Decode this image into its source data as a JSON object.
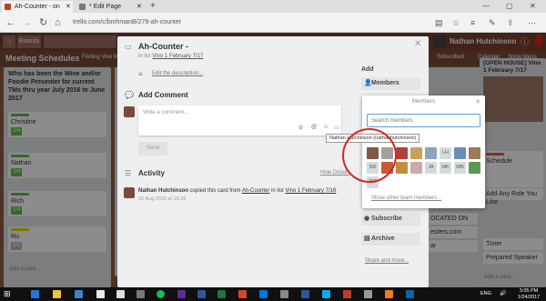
{
  "browser": {
    "tabs": [
      {
        "title": "Ah-Counter - on Meet",
        "active": true
      },
      {
        "title": "* Edit Page",
        "active": false
      }
    ],
    "tab_close": "✕",
    "url": "trello.com/c/bmhmanB/278-ah-counter"
  },
  "trello_header": {
    "boards_label": "Boards",
    "user_name": "Nathan Hutchinson"
  },
  "board": {
    "title": "Meeting Schedules",
    "menu_items": [
      "Finding Vino M...",
      "Subscribed",
      "Calendar",
      "Show Menu"
    ],
    "lists": [
      {
        "name": "Who has been the Wine and/or Foodie Presenter for current TMs thru year July 2016 to June 2017",
        "cards": [
          {
            "title": "Christine",
            "label_color": "#61bd4f",
            "badge": "2/4"
          },
          {
            "title": "Nathan",
            "label_color": "#61bd4f",
            "badge": "2/4"
          },
          {
            "title": "Rich",
            "label_color": "#61bd4f",
            "badge": "2/4"
          },
          {
            "title": "Ru",
            "label_color": "#f2d600",
            "badge": "1/2"
          }
        ],
        "add_card": "Add a card..."
      }
    ],
    "right_list": {
      "title": "[OPEN HOUSE] Vino 1 February 7/17",
      "cards": [
        "Schedule",
        "Add Any Role You Like",
        "Timer",
        "Prepared Speaker"
      ],
      "snippets": [
        "OCATED ON",
        "esters.com",
        "ar"
      ],
      "add_card": "Add a card..."
    }
  },
  "modal": {
    "title": "Ah-Counter -",
    "in_list_prefix": "in list",
    "in_list_name": "Vino 1 February 7/17",
    "edit_description": "Edit the description...",
    "add_comment_heading": "Add Comment",
    "comment_placeholder": "Write a comment...",
    "comment_tools": [
      "⊘",
      "@",
      "☺",
      "▭"
    ],
    "send_label": "Send",
    "activity_heading": "Activity",
    "hide_details": "Hide Details",
    "activity": {
      "user": "Nathan Hutchinson",
      "action": " copied this card from ",
      "source": "Ah-Counter",
      "mid": " in list ",
      "list": "Vino 1 February 7/16",
      "time": "15 Aug 2016 at 15:26"
    },
    "add_heading": "Add",
    "side_buttons": [
      {
        "label": "Members",
        "icon": "person-icon"
      },
      {
        "label": "Subscribe",
        "icon": "eye-icon"
      },
      {
        "label": "Archive",
        "icon": "archive-icon"
      }
    ],
    "share_more": "Share and more..."
  },
  "members_popover": {
    "title": "Members",
    "search_placeholder": "Search members",
    "members": [
      {
        "initials": "",
        "color": "#7d5a48"
      },
      {
        "initials": "",
        "color": "#a0a0a0"
      },
      {
        "initials": "",
        "color": "#b0413e"
      },
      {
        "initials": "",
        "color": "#c8a05a"
      },
      {
        "initials": "",
        "color": "#8fa3c0"
      },
      {
        "initials": "LH",
        "color": "#d6dadc"
      },
      {
        "initials": "",
        "color": "#6a8fb5"
      },
      {
        "initials": "",
        "color": "#9a7b5b"
      },
      {
        "initials": "SR",
        "color": "#d6dadc"
      },
      {
        "initials": "",
        "color": "#c75a3a"
      },
      {
        "initials": "",
        "color": "#bf8d3f"
      },
      {
        "initials": "",
        "color": "#caa"
      },
      {
        "initials": "JA",
        "color": "#d6dadc"
      },
      {
        "initials": "MK",
        "color": "#d6dadc"
      },
      {
        "initials": "MN",
        "color": "#d6dadc"
      },
      {
        "initials": "",
        "color": "#5c9a52"
      },
      {
        "initials": "RH",
        "color": "#d6dadc"
      }
    ],
    "show_other": "Show other team members..."
  },
  "tooltip": "Nathan Hutchinson (nathanhutchinson)",
  "taskbar": {
    "lang": "ENG",
    "time": "3:05 PM",
    "date": "1/24/2017"
  }
}
